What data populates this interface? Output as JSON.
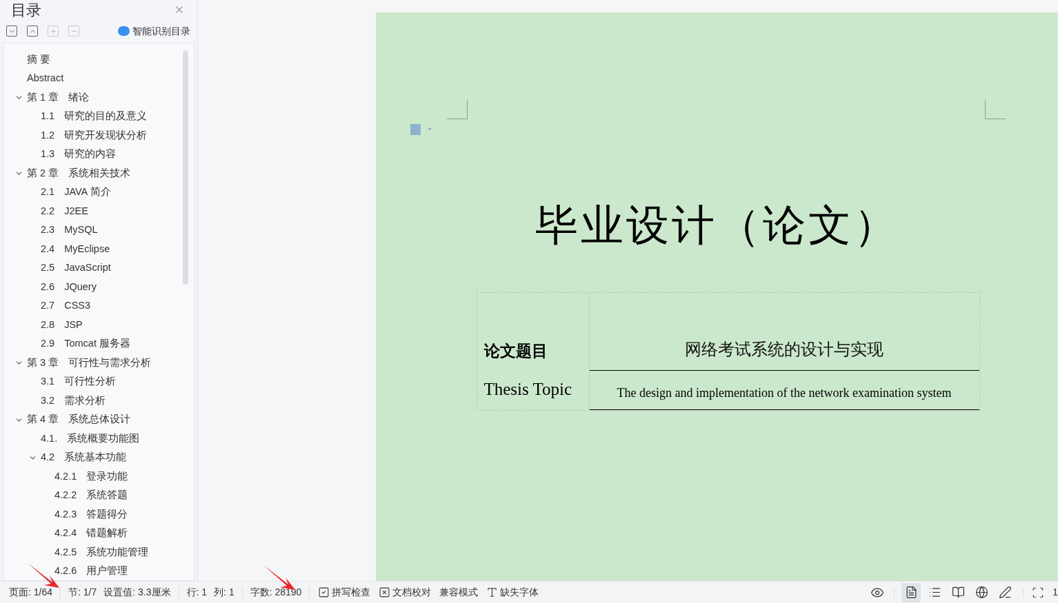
{
  "sidebar": {
    "title": "目录",
    "tools": [
      {
        "kind": "collapse",
        "disabled": false
      },
      {
        "kind": "expand",
        "disabled": false
      },
      {
        "kind": "plus",
        "disabled": true
      },
      {
        "kind": "minus",
        "disabled": true
      }
    ],
    "smart_button": "智能识别目录",
    "tree": [
      {
        "title": "摘 要"
      },
      {
        "title": "Abstract"
      },
      {
        "number": "第 1 章",
        "title": "绪论",
        "expanded": true,
        "children": [
          {
            "number": "1.1",
            "title": "研究的目的及意义"
          },
          {
            "number": "1.2",
            "title": "研究开发现状分析"
          },
          {
            "number": "1.3",
            "title": "研究的内容"
          }
        ]
      },
      {
        "number": "第 2 章",
        "title": "系统相关技术",
        "expanded": true,
        "children": [
          {
            "number": "2.1",
            "title": "JAVA 简介"
          },
          {
            "number": "2.2",
            "title": "J2EE"
          },
          {
            "number": "2.3",
            "title": "MySQL"
          },
          {
            "number": "2.4",
            "title": "MyEclipse"
          },
          {
            "number": "2.5",
            "title": "JavaScript"
          },
          {
            "number": "2.6",
            "title": "JQuery"
          },
          {
            "number": "2.7",
            "title": "CSS3"
          },
          {
            "number": "2.8",
            "title": "JSP"
          },
          {
            "number": "2.9",
            "title": "Tomcat 服务器"
          }
        ]
      },
      {
        "number": "第 3 章",
        "title": "可行性与需求分析",
        "expanded": true,
        "children": [
          {
            "number": "3.1",
            "title": "可行性分析"
          },
          {
            "number": "3.2",
            "title": "需求分析"
          }
        ]
      },
      {
        "number": "第 4 章",
        "title": "系统总体设计",
        "expanded": true,
        "children": [
          {
            "number": "4.1.",
            "title": "系统概要功能图"
          },
          {
            "number": "4.2",
            "title": "系统基本功能",
            "expanded": true,
            "children": [
              {
                "number": "4.2.1",
                "title": "登录功能"
              },
              {
                "number": "4.2.2",
                "title": "系统答题"
              },
              {
                "number": "4.2.3",
                "title": "答题得分"
              },
              {
                "number": "4.2.4",
                "title": "错题解析"
              },
              {
                "number": "4.2.5",
                "title": "系统功能管理"
              },
              {
                "number": "4.2.6",
                "title": "用户管理"
              }
            ]
          }
        ]
      }
    ]
  },
  "document": {
    "title": "毕业设计（论文）",
    "rows": [
      {
        "label": "论文题目",
        "value": "网络考试系统的设计与实现",
        "kind": "cn"
      },
      {
        "label": "Thesis Topic",
        "value": "The design and implementation of the network examination system",
        "kind": "en"
      }
    ]
  },
  "status_bar": {
    "items": [
      "页面: 1/64",
      "节: 1/7",
      "设置值: 3.3厘米",
      "行: 1",
      "列: 1",
      "字数: 28190"
    ],
    "tools": [
      {
        "kind": "check",
        "label": "拼写检查"
      },
      {
        "kind": "box-x",
        "label": "文档校对"
      },
      {
        "kind": "plain",
        "label": "兼容模式"
      },
      {
        "kind": "font",
        "label": "缺失字体"
      }
    ],
    "views": [
      {
        "kind": "page",
        "selected": true
      },
      {
        "kind": "outline",
        "selected": false
      },
      {
        "kind": "read",
        "selected": false
      },
      {
        "kind": "web",
        "selected": false
      },
      {
        "kind": "pen",
        "selected": false
      }
    ],
    "zoom": "1"
  }
}
